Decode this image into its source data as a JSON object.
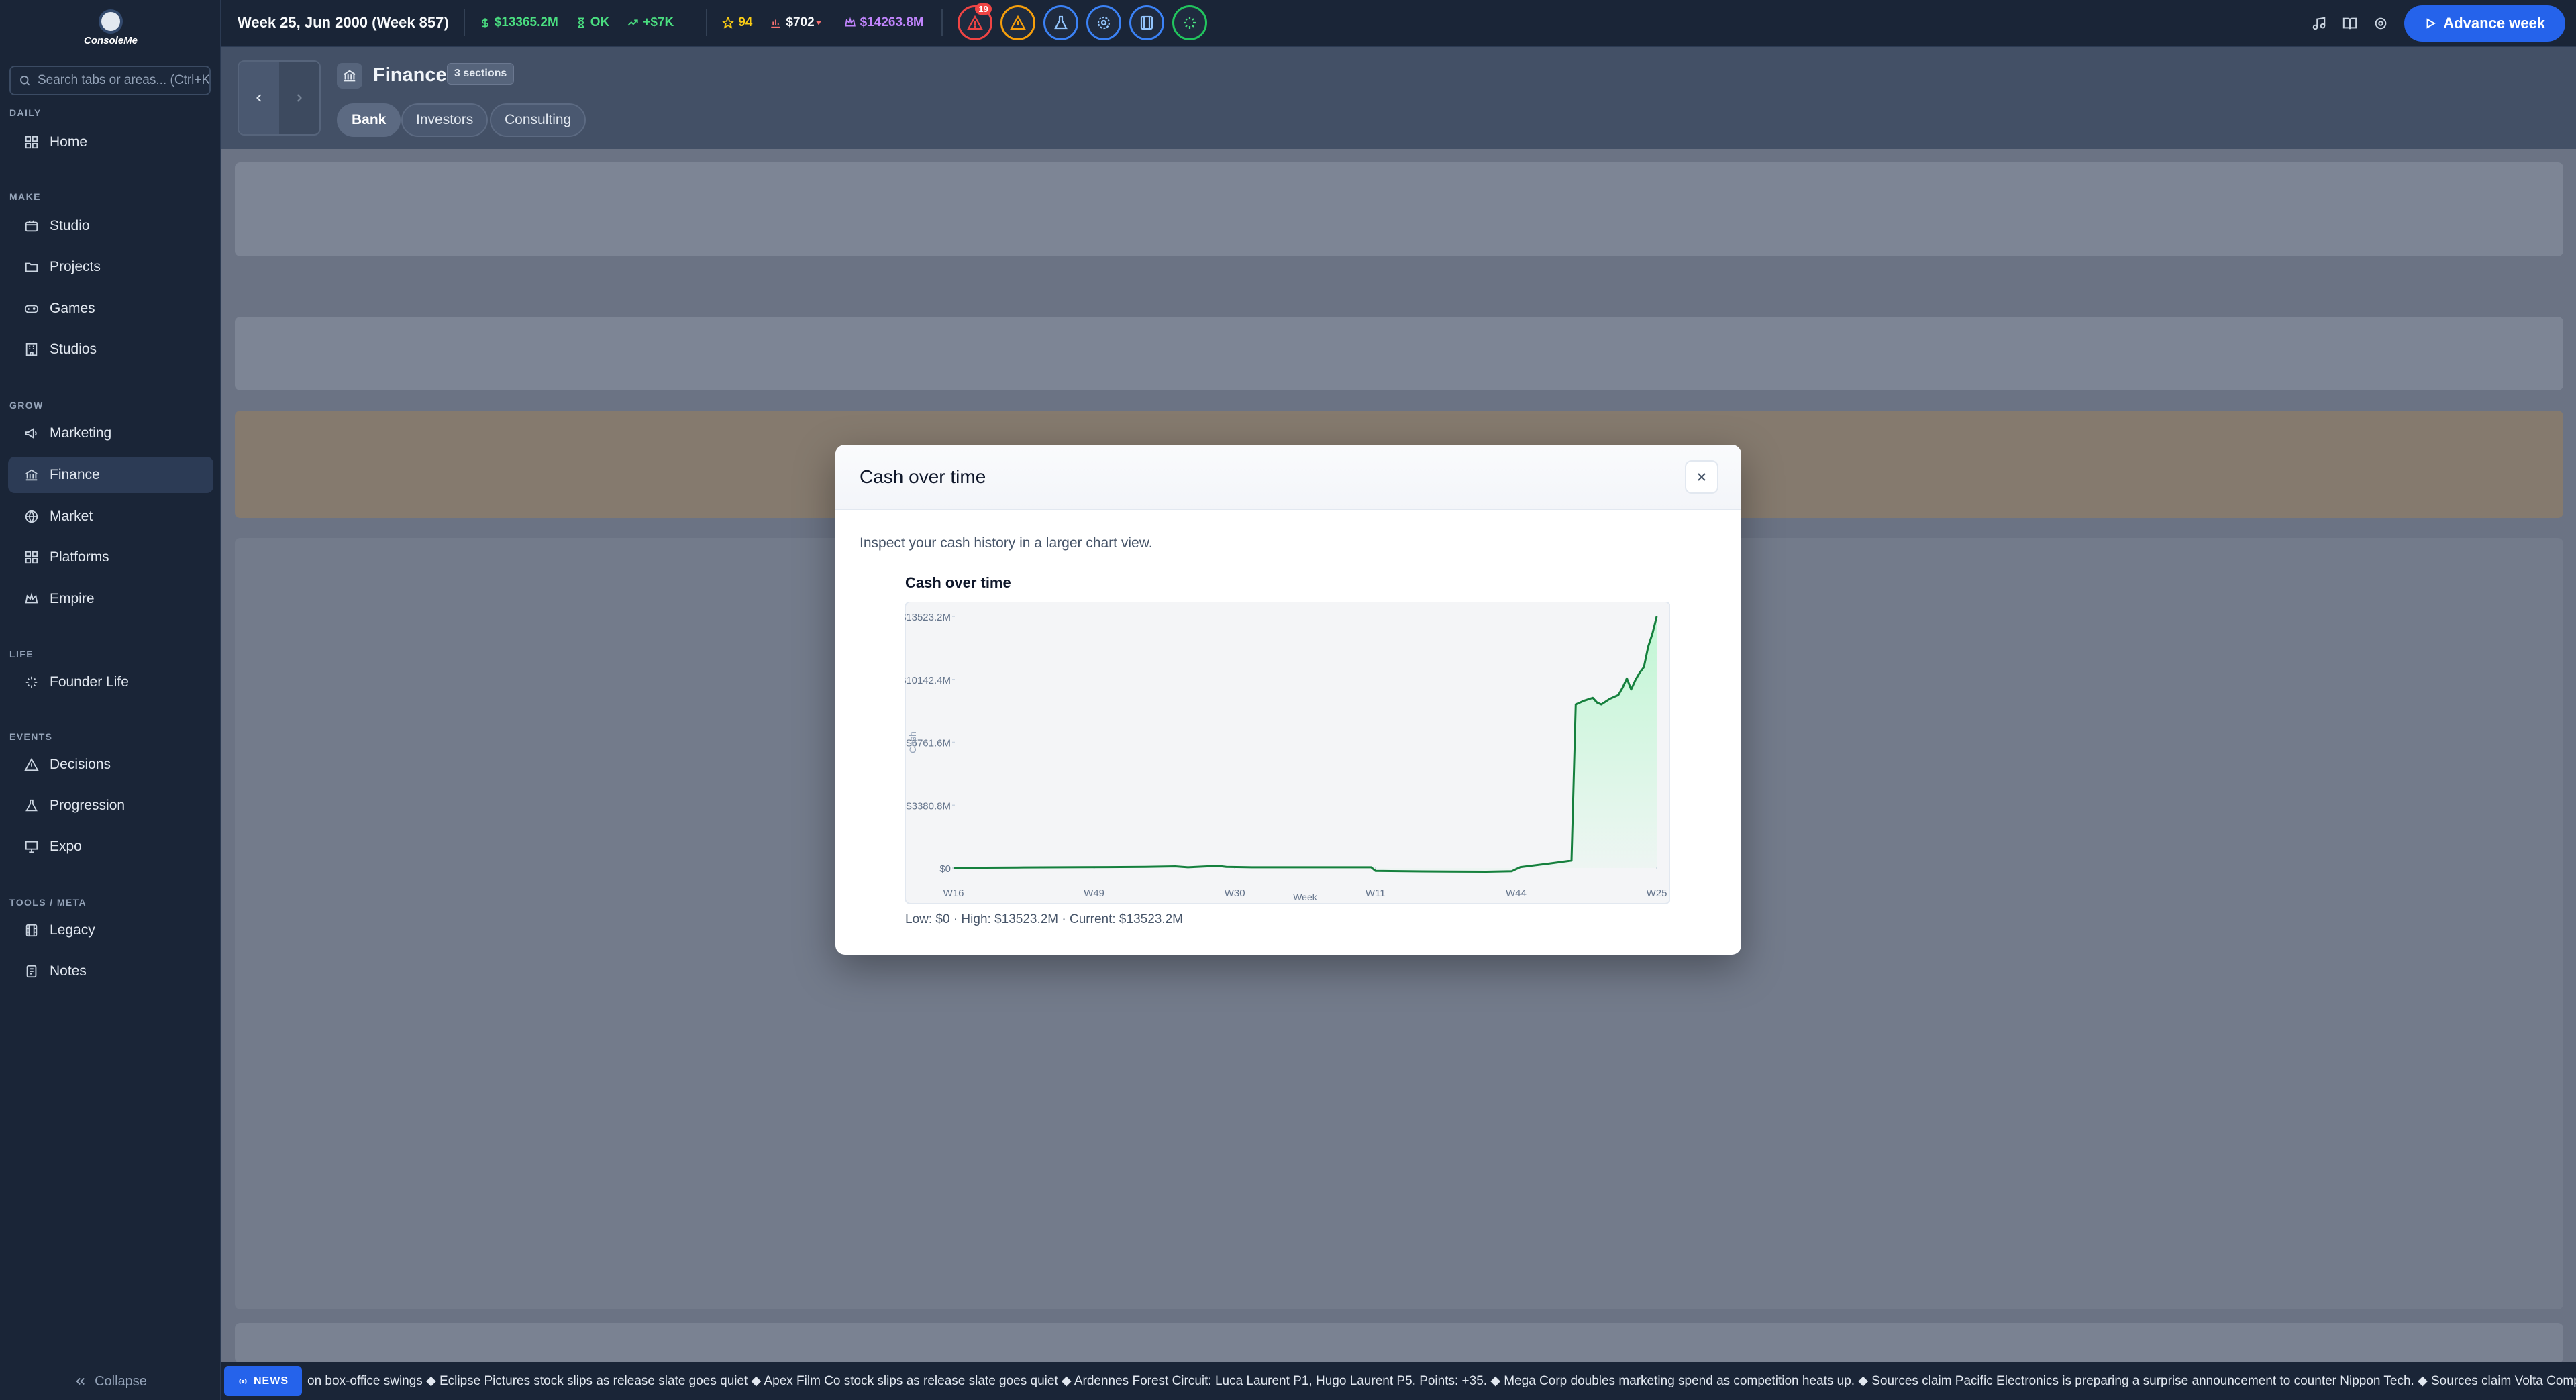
{
  "sidebar": {
    "logo_text": "ConsoleMe",
    "search_placeholder": "Search tabs or areas... (Ctrl+K)",
    "sections": [
      {
        "label": "DAILY",
        "items": [
          {
            "label": "Home",
            "icon": "grid-icon"
          }
        ]
      },
      {
        "label": "MAKE",
        "items": [
          {
            "label": "Studio",
            "icon": "studio-icon"
          },
          {
            "label": "Projects",
            "icon": "folder-icon"
          },
          {
            "label": "Games",
            "icon": "gamepad-icon"
          },
          {
            "label": "Studios",
            "icon": "building-icon"
          }
        ]
      },
      {
        "label": "GROW",
        "items": [
          {
            "label": "Marketing",
            "icon": "megaphone-icon"
          },
          {
            "label": "Finance",
            "icon": "bank-icon",
            "active": true
          },
          {
            "label": "Market",
            "icon": "globe-icon"
          },
          {
            "label": "Platforms",
            "icon": "grid-icon"
          },
          {
            "label": "Empire",
            "icon": "crown-icon"
          }
        ]
      },
      {
        "label": "LIFE",
        "items": [
          {
            "label": "Founder Life",
            "icon": "sparkles-icon"
          }
        ]
      },
      {
        "label": "EVENTS",
        "items": [
          {
            "label": "Decisions",
            "icon": "warning-icon"
          },
          {
            "label": "Progression",
            "icon": "flask-icon"
          },
          {
            "label": "Expo",
            "icon": "presentation-icon"
          }
        ]
      },
      {
        "label": "TOOLS / META",
        "items": [
          {
            "label": "Legacy",
            "icon": "film-icon"
          },
          {
            "label": "Notes",
            "icon": "notes-icon"
          }
        ]
      }
    ],
    "collapse_label": "Collapse"
  },
  "topbar": {
    "week": "Week 25, Jun 2000 (Week 857)",
    "cash": "$13365.2M",
    "status": "OK",
    "income": "+$7K",
    "rating": "94",
    "price": "$702",
    "net_worth": "$14263.8M",
    "alert_count": "19",
    "advance_label": "Advance week",
    "colors": {
      "cash": "#4ade80",
      "rating": "#facc15",
      "price": "#f8fafc",
      "net_worth": "#c084fc"
    }
  },
  "header": {
    "title": "Finance",
    "sections_badge": "3 sections",
    "tabs": [
      {
        "label": "Bank",
        "active": true
      },
      {
        "label": "Investors"
      },
      {
        "label": "Consulting"
      }
    ]
  },
  "news": {
    "label": "NEWS",
    "ticker": "on box-office swings ◆ Eclipse Pictures stock slips as release slate goes quiet ◆ Apex Film Co stock slips as release slate goes quiet ◆ Ardennes Forest Circuit: Luca Laurent P1, Hugo Laurent P5. Points: +35. ◆ Mega Corp doubles marketing spend as competition heats up. ◆ Sources claim Pacific Electronics is preparing a surprise announcement to counter Nippon Tech. ◆ Sources claim Volta Compu"
  },
  "modal": {
    "title": "Cash over time",
    "description": "Inspect your cash history in a larger chart view.",
    "stats_line": "Low: $0 · High: $13523.2M · Current: $13523.2M"
  },
  "chart_data": {
    "type": "area",
    "title": "Cash over time",
    "xlabel": "Week",
    "ylabel": "Cash",
    "y_tick_labels": [
      "$0",
      "$3380.8M",
      "$6761.6M",
      "$10142.4M",
      "$13523.2M"
    ],
    "y_ticks": [
      0,
      3380.8,
      6761.6,
      10142.4,
      13523.2
    ],
    "ylim": [
      0,
      13523.2
    ],
    "x_tick_labels": [
      "W16",
      "W49",
      "W30",
      "W11",
      "W44",
      "W25"
    ],
    "x_tick_positions": [
      0,
      33,
      66,
      99,
      132,
      165
    ],
    "xlim": [
      0,
      165
    ],
    "line_color": "#15803d",
    "fill_color": "#bbf7d0",
    "grid": false,
    "points": [
      [
        0,
        12
      ],
      [
        15,
        30
      ],
      [
        30,
        45
      ],
      [
        45,
        60
      ],
      [
        52,
        90
      ],
      [
        55,
        40
      ],
      [
        62,
        120
      ],
      [
        64,
        60
      ],
      [
        70,
        40
      ],
      [
        85,
        40
      ],
      [
        98,
        40
      ],
      [
        99,
        -150
      ],
      [
        110,
        -180
      ],
      [
        125,
        -200
      ],
      [
        131,
        -170
      ],
      [
        133,
        50
      ],
      [
        140,
        250
      ],
      [
        145,
        400
      ],
      [
        146,
        8800
      ],
      [
        148,
        9000
      ],
      [
        150,
        9150
      ],
      [
        151,
        8900
      ],
      [
        152,
        8800
      ],
      [
        154,
        9100
      ],
      [
        156,
        9300
      ],
      [
        157,
        9700
      ],
      [
        158,
        10200
      ],
      [
        159,
        9600
      ],
      [
        160,
        10100
      ],
      [
        161,
        10500
      ],
      [
        162,
        10800
      ],
      [
        163,
        11900
      ],
      [
        164,
        12600
      ],
      [
        165,
        13523.2
      ]
    ]
  }
}
